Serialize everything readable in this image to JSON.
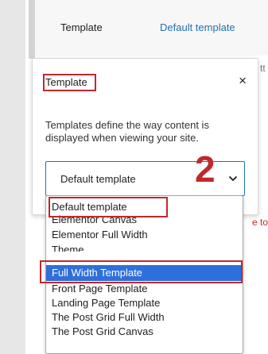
{
  "background": {
    "template_label": "Template",
    "template_value": "Default template",
    "peek_right_top": "tt",
    "peek_right_mid": "e to"
  },
  "popover": {
    "title": "Template",
    "close_icon": "×",
    "description": "Templates define the way content is displayed when viewing your site.",
    "select_value": "Default template",
    "step_number": "2"
  },
  "dropdown": {
    "options": [
      "Default template",
      "Elementor Canvas",
      "Elementor Full Width",
      "Theme",
      "Full Width Template",
      "Front Page Template",
      "Landing Page Template",
      "The Post Grid Full Width",
      "The Post Grid Canvas"
    ],
    "highlighted": "Full Width Template"
  },
  "colors": {
    "accent": "#2271b1",
    "highlight": "#2f6fdc",
    "annotation": "#c0282d"
  }
}
